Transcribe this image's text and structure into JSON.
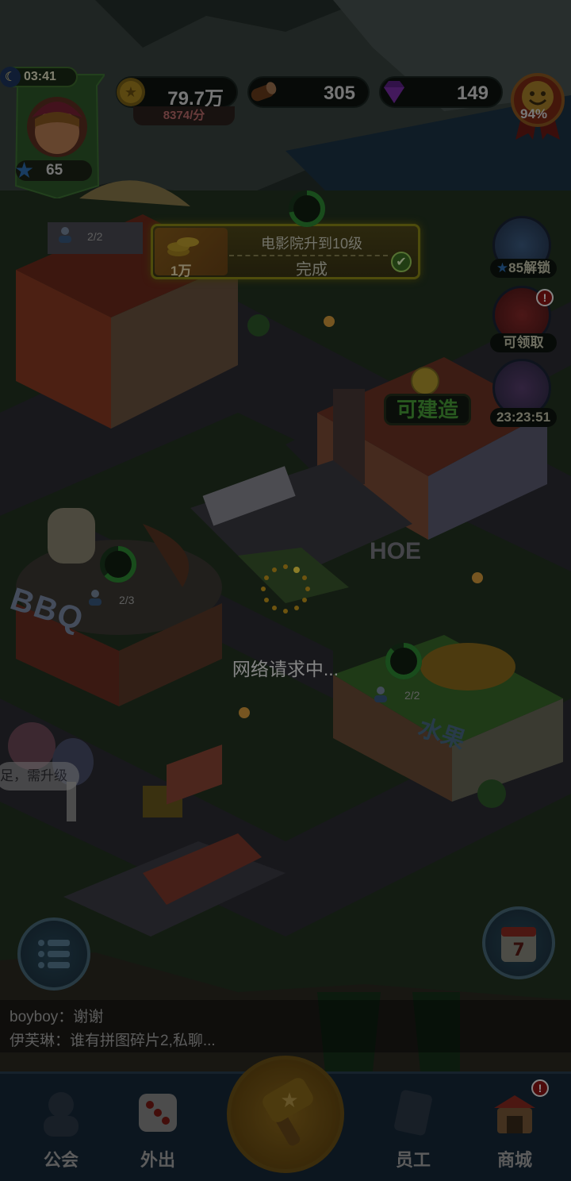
{
  "hud": {
    "clock": "03:41",
    "player_level": "65",
    "coins": "79.7万",
    "coin_rate": "8374/分",
    "wood": "305",
    "gems": "149",
    "satisfaction": "94%"
  },
  "task": {
    "reward_amount": "1万",
    "title": "电影院升到10级",
    "status": "完成"
  },
  "side_buttons": {
    "unlock_label": "85解锁",
    "gift_label": "可领取",
    "mail_timer": "23:23:51"
  },
  "map": {
    "buildable_label": "可建造",
    "occupancy_top": "2/2",
    "occupancy_bbq": "2/3",
    "occupancy_fruit": "2/2",
    "bbq_sign": "BBQ",
    "fruit_sign": "水果",
    "hoe_sign": "HOE",
    "upgrade_note": "足，需升级"
  },
  "loading_text": "网络请求中...",
  "chat": {
    "line1_user": "boyboy：",
    "line1_msg": "谢谢",
    "line2_user": "伊芙琳：",
    "line2_msg": "谁有拼图碎片2,私聊..."
  },
  "bottom_nav": {
    "guild": "公会",
    "outing": "外出",
    "staff": "员工",
    "shop": "商城",
    "shop_badge": "!"
  },
  "colors": {
    "coin": "#c9a225",
    "gem": "#7a2ea8",
    "buildable_green": "#4aa13a",
    "nav_bg": "#17283a"
  }
}
